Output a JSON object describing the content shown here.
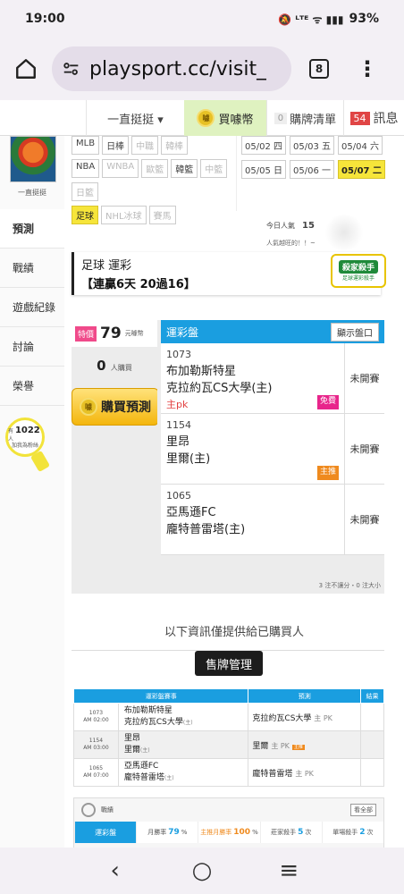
{
  "status": {
    "time": "19:00",
    "battery": "93%",
    "icons_label": "🔕 ᴸᵀᴱ ᯤ ▮▮▮"
  },
  "browser": {
    "url": "playsport.cc/visit_",
    "tab_count": "8"
  },
  "site_nav": {
    "user_name": "一直挺挺 ▾",
    "buy_coin": "買噱幣",
    "coin_text": "噱",
    "cart_count": "0",
    "cart_label": "購牌清單",
    "msg_count": "54",
    "msg_label": "訊息"
  },
  "sidebar": {
    "avatar_name": "一直挺挺",
    "items": [
      {
        "label": "預測"
      },
      {
        "label": "戰績"
      },
      {
        "label": "遊戲紀錄"
      },
      {
        "label": "討論"
      },
      {
        "label": "榮譽"
      }
    ],
    "fans_prefix": "有",
    "fans_count": "1022",
    "fans_unit": "人",
    "fans_suffix": "加我為粉絲"
  },
  "leagues": {
    "row1": [
      "MLB",
      "日棒",
      "中職",
      "韓棒"
    ],
    "row2": [
      "NBA",
      "WNBA",
      "歐籃",
      "韓籃",
      "中籃"
    ],
    "row3": [
      "日籃"
    ],
    "row4": [
      "足球",
      "NHL冰球",
      "賽馬"
    ]
  },
  "dates": {
    "row1": [
      "05/02 四",
      "05/03 五",
      "05/04 六"
    ],
    "row2": [
      "05/05 日",
      "05/06 一",
      "05/07 二"
    ]
  },
  "popularity": {
    "label": "今日人氣",
    "value": "15",
    "sub": "人氣越旺的！！~"
  },
  "event": {
    "title": "足球 運彩",
    "streak": "【連贏6天 20過16】",
    "expert_title": "殺家殺手",
    "expert_sub": "足球運彩殺手"
  },
  "buy": {
    "tag": "特價",
    "price": "79",
    "unit": "元噱幣",
    "buyers": "0",
    "buyers_unit": "人購買",
    "button": "購買預測",
    "coin_text": "噱"
  },
  "picks": {
    "header": "運彩盤",
    "show_button": "顯示盤口",
    "rows": [
      {
        "code": "1073",
        "team1": "布加勒斯特星",
        "team2": "克拉約瓦CS大學(主)",
        "selection": "主pk",
        "status": "未開賽",
        "tag": "免費"
      },
      {
        "code": "1154",
        "team1": "里昂",
        "team2": "里爾(主)",
        "selection": "",
        "status": "未開賽",
        "tag": "主推"
      },
      {
        "code": "1065",
        "team1": "亞馬遜FC",
        "team2": "龐特普雷塔(主)",
        "selection": "",
        "status": "未開賽",
        "tag": ""
      }
    ],
    "note": "3 注不讓分・0 注大小"
  },
  "buyer_note": "以下資訊僅提供給已購買人",
  "sell_button": "售牌管理",
  "table": {
    "headers": [
      "運彩盤賽事",
      "預測",
      "結果"
    ],
    "rows": [
      {
        "code": "1073",
        "time": "AM 02:00",
        "team1": "布加勒斯特星",
        "team2": "克拉約瓦CS大學",
        "home_mark": "(主)",
        "pick": "克拉約瓦CS大學",
        "handicap": "主 PK",
        "tag": ""
      },
      {
        "code": "1154",
        "time": "AM 03:00",
        "team1": "里昂",
        "team2": "里爾",
        "home_mark": "(主)",
        "pick": "里爾",
        "handicap": "主 PK",
        "tag": "主推"
      },
      {
        "code": "1065",
        "time": "AM 07:00",
        "team1": "亞馬遜FC",
        "team2": "龐特普雷塔",
        "home_mark": "(主)",
        "pick": "龐特普雷塔",
        "handicap": "主 PK",
        "tag": ""
      }
    ]
  },
  "record": {
    "title": "戰績",
    "see_all": "看全部",
    "bar_label": "運彩盤",
    "month_win_label": "月勝率",
    "month_win": "79",
    "month_win_unit": "%",
    "main_win_label": "主推月勝率",
    "main_win": "100",
    "main_win_unit": "%",
    "king_label": "莊家殺手",
    "king": "5",
    "king_unit": "次",
    "single_label": "單場殺手",
    "single": "2",
    "single_unit": "次"
  },
  "bottom_nav": {
    "back": "‹",
    "home": "○",
    "menu": "≡"
  }
}
